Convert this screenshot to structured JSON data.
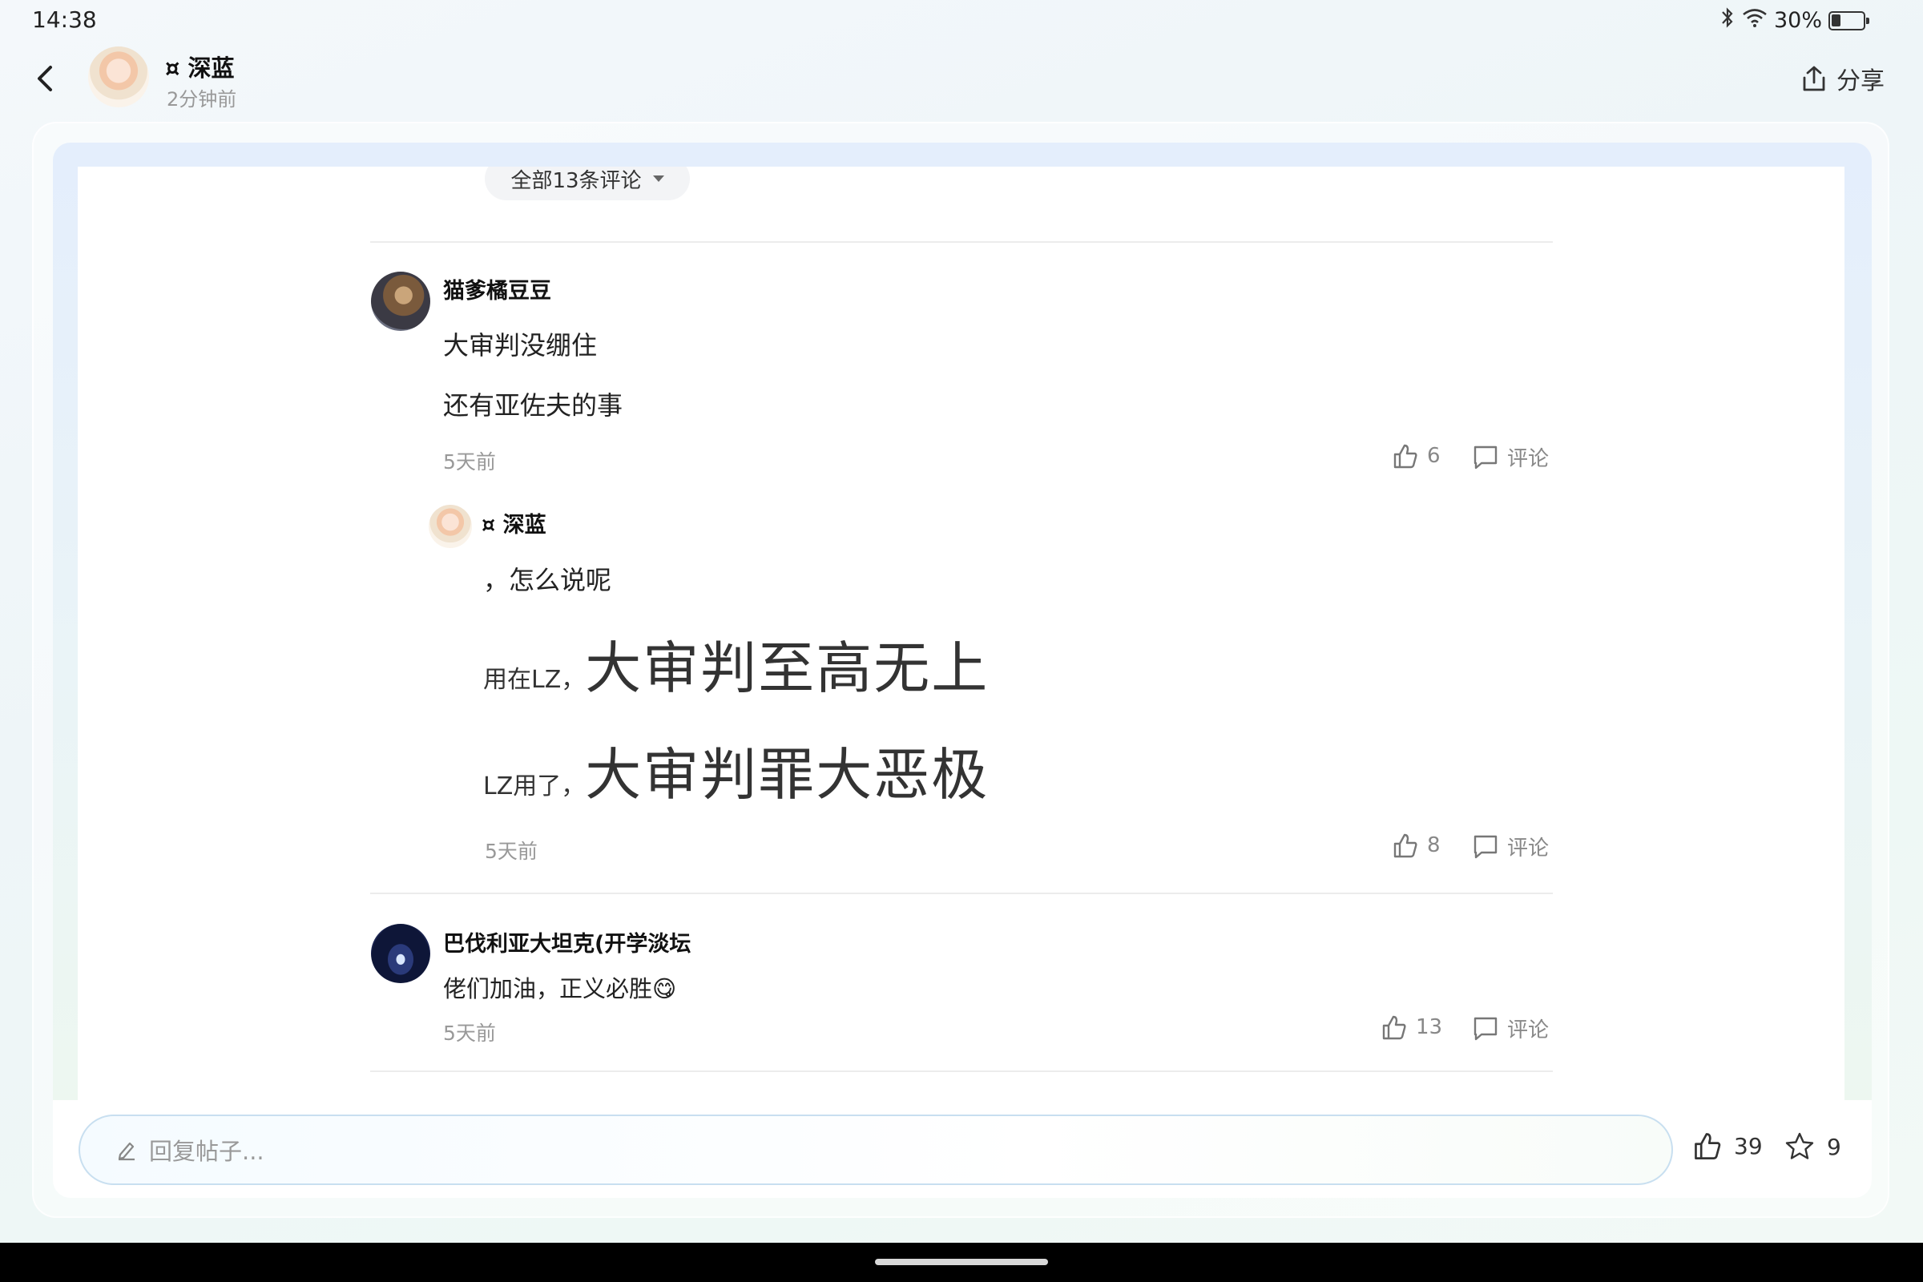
{
  "status_bar": {
    "time": "14:38",
    "battery": "30%"
  },
  "header": {
    "author": "¤ 深蓝",
    "time": "2分钟前",
    "share_label": "分享"
  },
  "filter": {
    "label": "全部13条评论"
  },
  "comments": [
    {
      "user": "猫爹橘豆豆",
      "lines": [
        "大审判没绷住",
        "还有亚佐夫的事"
      ],
      "time": "5天前",
      "likes": "6",
      "reply_label": "评论",
      "reply": {
        "user": "¤ 深蓝",
        "line1": "，怎么说呢",
        "line2_small": "用在LZ，",
        "line2_big": "大审判至高无上",
        "line3_small": "LZ用了，",
        "line3_big": "大审判罪大恶极",
        "time": "5天前",
        "likes": "8",
        "reply_label": "评论"
      }
    },
    {
      "user": "巴伐利亚大坦克(开学淡坛",
      "text": "佬们加油，正义必胜😋",
      "time": "5天前",
      "likes": "13",
      "reply_label": "评论"
    }
  ],
  "bottom_bar": {
    "placeholder": "回复帖子...",
    "likes": "39",
    "favorites": "9"
  },
  "icons": [
    "back-arrow-icon",
    "bluetooth-icon",
    "wifi-icon",
    "battery-icon",
    "share-icon",
    "thumb-up-icon",
    "comment-icon",
    "pencil-icon",
    "star-icon"
  ]
}
